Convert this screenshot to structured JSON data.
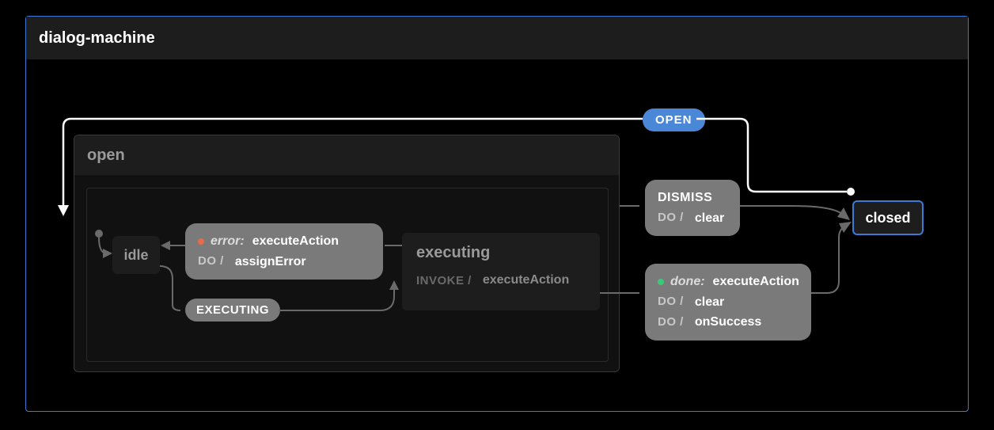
{
  "machine": {
    "title": "dialog-machine"
  },
  "states": {
    "open": {
      "label": "open"
    },
    "idle": {
      "label": "idle"
    },
    "executing": {
      "label": "executing",
      "invoke_kw": "INVOKE /",
      "invoke_name": "executeAction"
    },
    "closed": {
      "label": "closed"
    }
  },
  "transitions": {
    "open_event": {
      "label": "OPEN"
    },
    "executing_event": {
      "label": "EXECUTING"
    },
    "error": {
      "ev_label": "error:",
      "ev_name": "executeAction",
      "do_kw": "DO /",
      "action": "assignError"
    },
    "dismiss": {
      "label": "DISMISS",
      "do_kw": "DO /",
      "action": "clear"
    },
    "done": {
      "ev_label": "done:",
      "ev_name": "executeAction",
      "do_kw": "DO /",
      "action1": "clear",
      "action2": "onSuccess"
    }
  }
}
